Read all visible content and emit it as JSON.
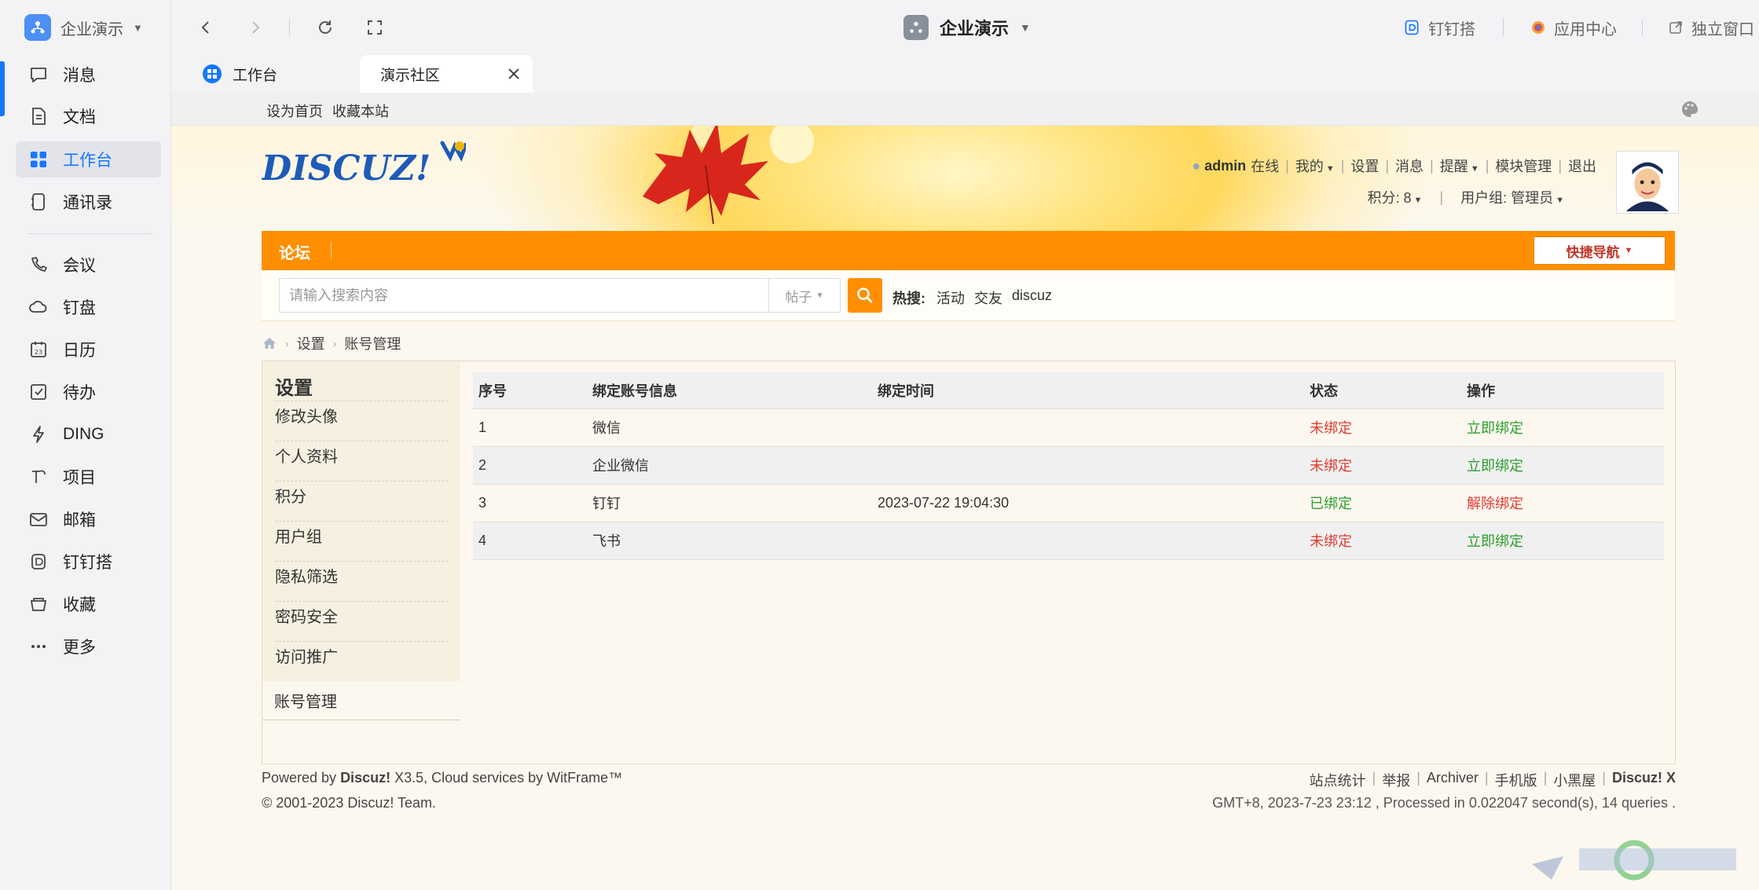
{
  "sidebar": {
    "org_name": "企业演示",
    "items": [
      {
        "label": "消息",
        "icon": "message-icon"
      },
      {
        "label": "文档",
        "icon": "document-icon"
      },
      {
        "label": "工作台",
        "icon": "workbench-icon",
        "active": true
      },
      {
        "label": "通讯录",
        "icon": "contacts-icon"
      },
      {
        "label": "会议",
        "icon": "meeting-icon"
      },
      {
        "label": "钉盘",
        "icon": "cloud-drive-icon"
      },
      {
        "label": "日历",
        "icon": "calendar-icon"
      },
      {
        "label": "待办",
        "icon": "todo-icon"
      },
      {
        "label": "DING",
        "icon": "ding-icon"
      },
      {
        "label": "项目",
        "icon": "project-icon"
      },
      {
        "label": "邮箱",
        "icon": "mail-icon"
      },
      {
        "label": "钉钉搭",
        "icon": "dingda-icon"
      },
      {
        "label": "收藏",
        "icon": "favorite-icon"
      },
      {
        "label": "更多",
        "icon": "more-icon"
      }
    ]
  },
  "topbar": {
    "title": "企业演示",
    "links": {
      "dingda": "钉钉搭",
      "app_center": "应用中心",
      "standalone": "独立窗口"
    }
  },
  "tabs": [
    {
      "label": "工作台"
    },
    {
      "label": "演示社区",
      "active": true
    }
  ],
  "bookmarks": {
    "set_home": "设为首页",
    "favorite": "收藏本站"
  },
  "site": {
    "logo_text": "DISCUZ!",
    "user": {
      "name": "admin",
      "status": "在线",
      "menu": [
        "我的",
        "设置",
        "消息",
        "提醒",
        "模块管理",
        "退出"
      ],
      "points": "积分: 8",
      "group": "用户组: 管理员"
    },
    "nav": {
      "forum": "论坛",
      "quick_nav": "快捷导航"
    },
    "search": {
      "placeholder": "请输入搜索内容",
      "type": "帖子",
      "hot_label": "热搜:",
      "hot_terms": [
        "活动",
        "交友",
        "discuz"
      ]
    },
    "breadcrumb": [
      "设置",
      "账号管理"
    ],
    "side_menu": {
      "title": "设置",
      "items": [
        "修改头像",
        "个人资料",
        "积分",
        "用户组",
        "隐私筛选",
        "密码安全",
        "访问推广",
        "账号管理"
      ]
    },
    "table": {
      "headers": [
        "序号",
        "绑定账号信息",
        "绑定时间",
        "状态",
        "操作"
      ],
      "rows": [
        {
          "no": "1",
          "account": "微信",
          "time": "",
          "status": "未绑定",
          "action": "立即绑定",
          "bound": false
        },
        {
          "no": "2",
          "account": "企业微信",
          "time": "",
          "status": "未绑定",
          "action": "立即绑定",
          "bound": false
        },
        {
          "no": "3",
          "account": "钉钉",
          "time": "2023-07-22 19:04:30",
          "status": "已绑定",
          "action": "解除绑定",
          "bound": true
        },
        {
          "no": "4",
          "account": "飞书",
          "time": "",
          "status": "未绑定",
          "action": "立即绑定",
          "bound": false
        }
      ]
    },
    "footer": {
      "powered_prefix": "Powered by ",
      "powered_brand": "Discuz!",
      "powered_suffix": " X3.5, Cloud services by WitFrame™",
      "copyright": "© 2001-2023 Discuz! Team.",
      "links": [
        "站点统计",
        "举报",
        "Archiver",
        "手机版",
        "小黑屋"
      ],
      "brand": "Discuz! X",
      "stats": "GMT+8, 2023-7-23 23:12 , Processed in 0.022047 second(s), 14 queries ."
    }
  },
  "colors": {
    "accent": "#1677ff",
    "nav_orange": "#ff8f00",
    "status_unbound": "#e03c31",
    "status_bound": "#2d9e2d"
  }
}
